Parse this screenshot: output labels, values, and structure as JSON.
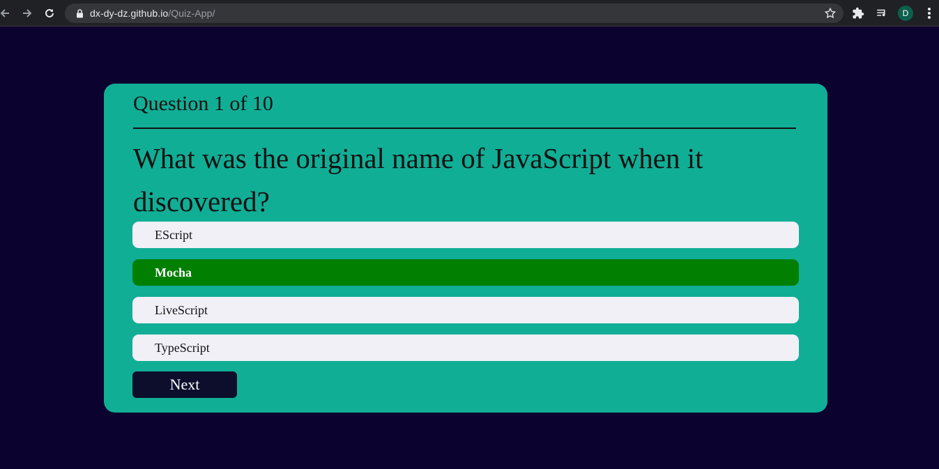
{
  "browser": {
    "url_host": "dx-dy-dz.github.io",
    "url_path": "/Quiz-App/",
    "profile_initial": "D",
    "icons": [
      "back-arrow-icon",
      "forward-arrow-icon",
      "reload-icon",
      "lock-icon",
      "star-icon",
      "extensions-icon",
      "media-queue-icon",
      "menu-dots-icon"
    ]
  },
  "quiz": {
    "counter": "Question 1 of 10",
    "question": "What was the original name of JavaScript when it discovered?",
    "options": [
      {
        "label": "EScript",
        "selected": false
      },
      {
        "label": "Mocha",
        "selected": true
      },
      {
        "label": "LiveScript",
        "selected": false
      },
      {
        "label": "TypeScript",
        "selected": false
      }
    ],
    "next_label": "Next"
  },
  "colors": {
    "page_background": "#0b0230",
    "card": "#11ae96",
    "option": "#f1f0f7",
    "selected_option": "#007f00",
    "next_button": "#0c0e2c"
  }
}
